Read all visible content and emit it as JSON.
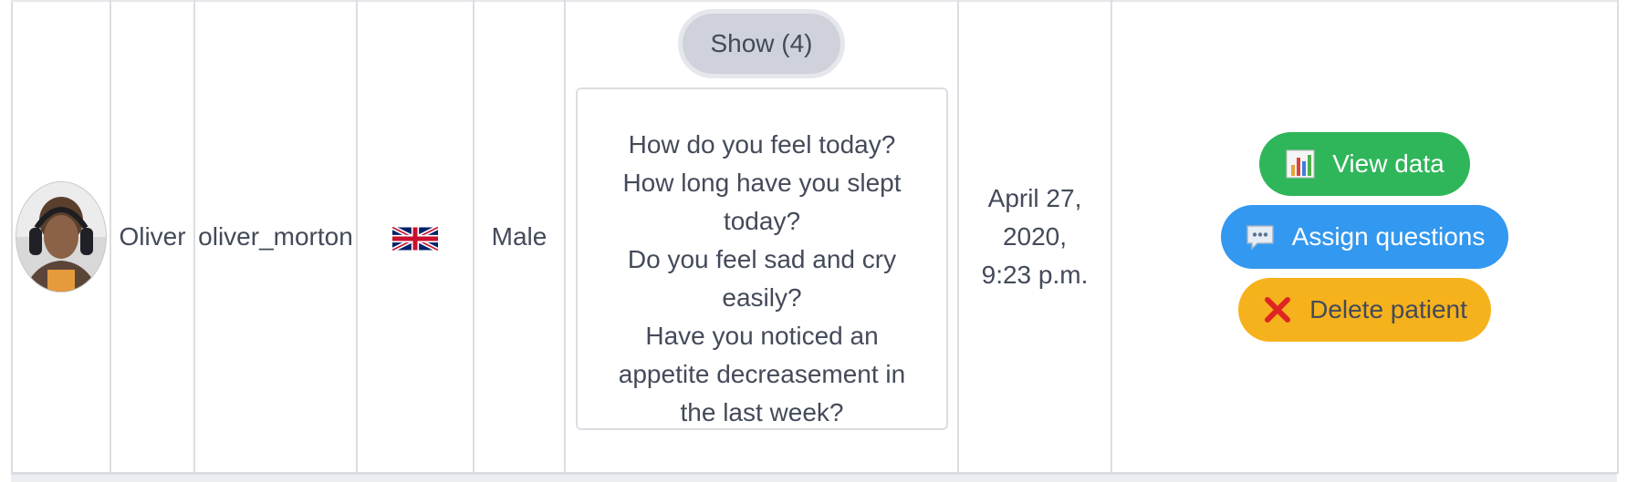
{
  "patient_row": {
    "avatar_alt": "",
    "name": "Oliver",
    "username": "oliver_morton",
    "flag_icon": "uk-flag-icon",
    "gender": "Male",
    "questions": {
      "show_label": "Show (4)",
      "items": [
        "How do you feel today?",
        "How long have you slept today?",
        "Do you feel sad and cry easily?",
        "Have you noticed an appetite decreasement in the last week?"
      ]
    },
    "date": "April 27, 2020, 9:23 p.m.",
    "actions": {
      "view_label": "View data",
      "view_icon": "bar-chart-icon",
      "assign_label": "Assign questions",
      "assign_icon": "speech-bubble-icon",
      "delete_label": "Delete patient",
      "delete_icon": "red-x-icon"
    }
  },
  "colors": {
    "view_button": "#2fb65a",
    "assign_button": "#3398ef",
    "delete_button": "#f6b21c",
    "show_button": "#cfd2da",
    "text": "#434a59"
  }
}
